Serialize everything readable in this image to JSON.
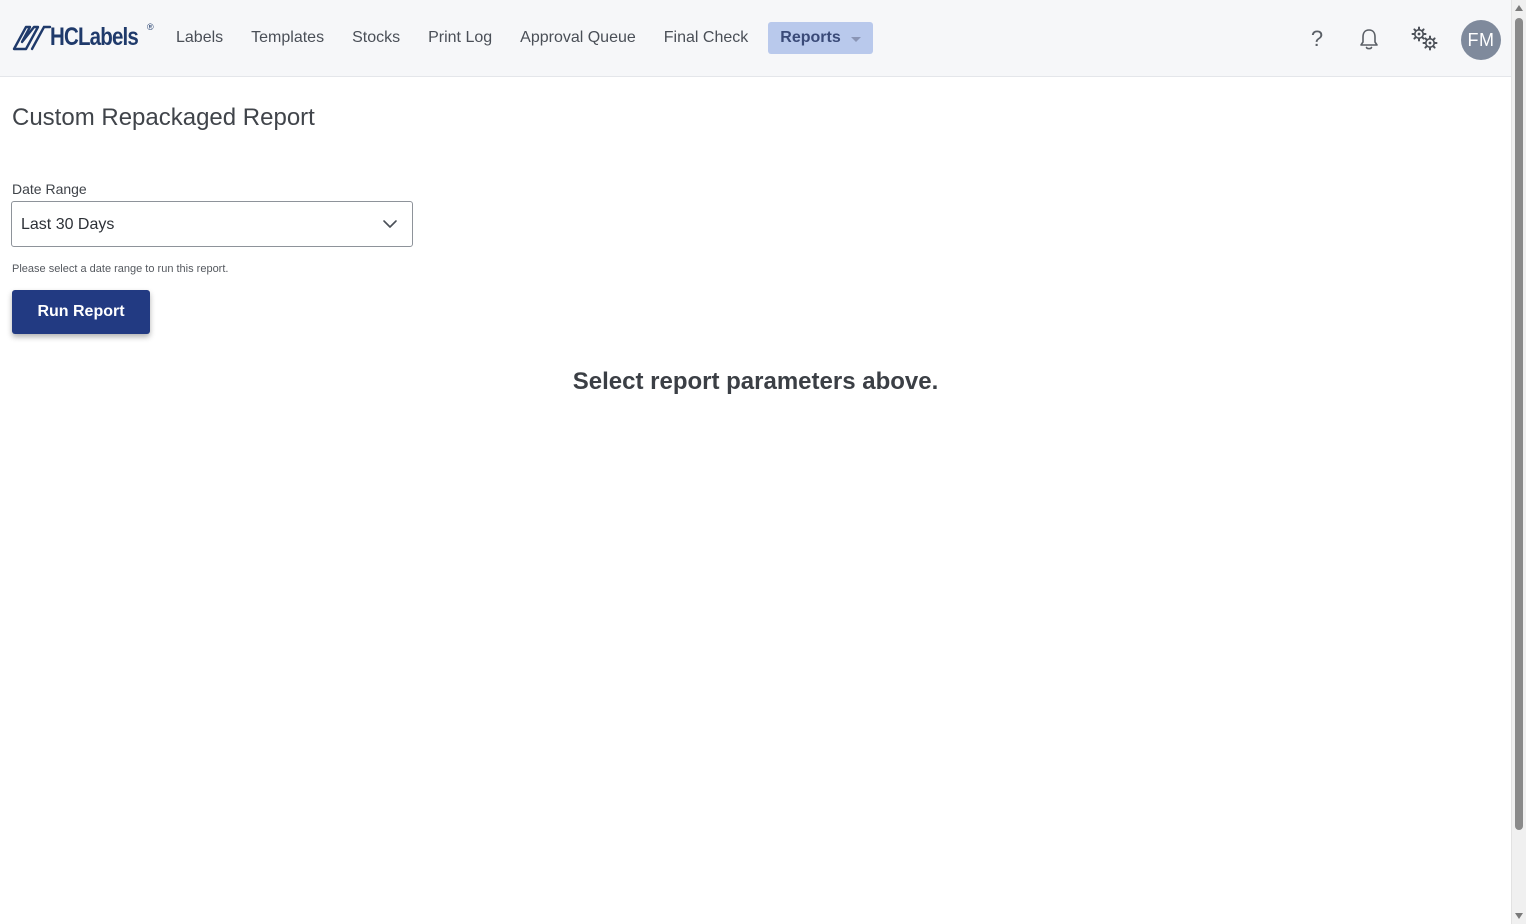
{
  "brand": {
    "name": "HCLabels",
    "registered_mark": "®",
    "color": "#1f3a6b"
  },
  "nav": {
    "items": [
      {
        "label": "Labels"
      },
      {
        "label": "Templates"
      },
      {
        "label": "Stocks"
      },
      {
        "label": "Print Log"
      },
      {
        "label": "Approval Queue"
      },
      {
        "label": "Final Check"
      }
    ],
    "active": {
      "label": "Reports",
      "icon": "caret-down-icon",
      "color": "#b9c9ec"
    }
  },
  "header_icons": {
    "help": {
      "glyph": "?",
      "icon": "help-icon"
    },
    "notifications": {
      "icon": "bell-icon"
    },
    "settings": {
      "icon": "gears-icon"
    },
    "avatar": {
      "initials": "FM",
      "color": "#7f8a9c"
    }
  },
  "page": {
    "title": "Custom Repackaged Report"
  },
  "form": {
    "date_range_label": "Date Range",
    "date_range_value": "Last 30 Days",
    "helper_text": "Please select a date range to run this report.",
    "run_button_label": "Run Report",
    "run_button_color": "#223a82"
  },
  "results": {
    "empty_message": "Select report parameters above."
  }
}
